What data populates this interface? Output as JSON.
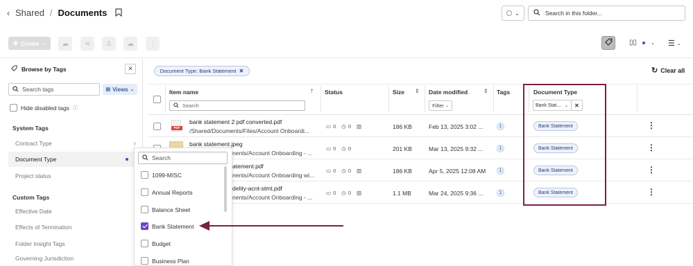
{
  "breadcrumb": {
    "parent": "Shared",
    "separator": "/",
    "current": "Documents"
  },
  "top_search": {
    "placeholder": "Search in this folder..."
  },
  "toolbar": {
    "create_label": "Create"
  },
  "tags_panel": {
    "title": "Browse by Tags",
    "search_placeholder": "Search tags",
    "views_label": "Views",
    "hide_disabled_label": "Hide disabled tags",
    "system_tags_heading": "System Tags",
    "system_tags": [
      {
        "label": "Contract Type"
      },
      {
        "label": "Document Type"
      },
      {
        "label": "Project status"
      }
    ],
    "custom_tags_heading": "Custom Tags",
    "custom_tags": [
      {
        "label": "Effective Date"
      },
      {
        "label": "Effects of Termination"
      },
      {
        "label": "Folder Insight Tags"
      },
      {
        "label": "Governing Jurisdiction"
      }
    ]
  },
  "tag_dropdown": {
    "search_placeholder": "Search",
    "options": [
      {
        "label": "1099-MISC",
        "checked": false
      },
      {
        "label": "Annual Reports",
        "checked": false
      },
      {
        "label": "Balance Sheet",
        "checked": false
      },
      {
        "label": "Bank Statement",
        "checked": true
      },
      {
        "label": "Budget",
        "checked": false
      },
      {
        "label": "Business Plan",
        "checked": false
      }
    ]
  },
  "active_filter": {
    "label": "Document Type: Bank Statement"
  },
  "clear_all_label": "Clear all",
  "table": {
    "columns": {
      "name": "Item name",
      "status": "Status",
      "size": "Size",
      "date": "Date modified",
      "tags": "Tags",
      "doctype": "Document Type"
    },
    "name_search_placeholder": "Search",
    "date_filter_label": "Filter",
    "doctype_filter_value": "Bank Stat...",
    "rows": [
      {
        "name": "bank statement 2 pdf converted.pdf",
        "path": "/Shared/Documents/Files/Account Onboardi...",
        "comments": "0",
        "versions": "0",
        "size": "186 KB",
        "date": "Feb 13, 2025 3:02 ...",
        "tags": "1",
        "doctype": "Bank Statement"
      },
      {
        "name": "bank statement.jpeg",
        "path": "nents/Account Onboarding - ...",
        "comments": "0",
        "versions": "0",
        "size": "201 KB",
        "date": "Mar 13, 2025 9:32 ...",
        "tags": "1",
        "doctype": "Bank Statement"
      },
      {
        "name": "atement.pdf",
        "path": "nents/Account Onboarding wi...",
        "comments": "0",
        "versions": "0",
        "size": "186 KB",
        "date": "Apr 5, 2025 12:08 AM",
        "tags": "1",
        "doctype": "Bank Statement"
      },
      {
        "name": "delity-acnt-stmt.pdf",
        "path": "nents/Account Onboarding - ...",
        "comments": "0",
        "versions": "0",
        "size": "1.1 MB",
        "date": "Mar 24, 2025 9:36 ...",
        "tags": "1",
        "doctype": "Bank Statement"
      }
    ]
  },
  "colors": {
    "accent": "#6b47c4",
    "highlight_border": "#7a1f45",
    "arrow": "#7a1f45"
  }
}
